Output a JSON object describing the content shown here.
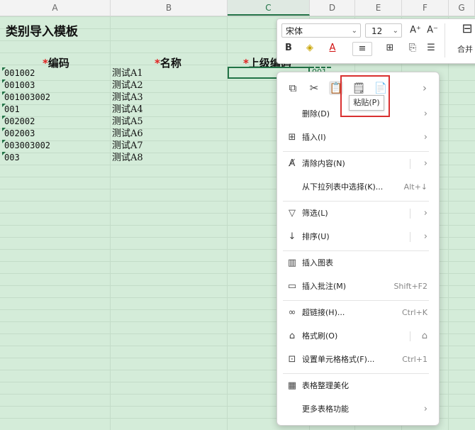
{
  "columns": [
    "A",
    "B",
    "C",
    "D",
    "E",
    "F",
    "G"
  ],
  "sheet": {
    "title": "类别导入模板",
    "headers": [
      {
        "star": "*",
        "label": "编码"
      },
      {
        "star": "*",
        "label": "名称"
      },
      {
        "star": "*",
        "label": "上级编码"
      }
    ],
    "rows": [
      {
        "code": "001002",
        "name": "测试A1"
      },
      {
        "code": "001003",
        "name": "测试A2"
      },
      {
        "code": "001003002",
        "name": "测试A3"
      },
      {
        "code": "001",
        "name": "测试A4"
      },
      {
        "code": "002002",
        "name": "测试A5"
      },
      {
        "code": "002003",
        "name": "测试A6"
      },
      {
        "code": "003003002",
        "name": "测试A7"
      },
      {
        "code": "003",
        "name": "测试A8"
      }
    ],
    "partial_cell_text": "001"
  },
  "toolbar": {
    "font": "宋体",
    "size": "12",
    "grow": "A⁺",
    "shrink": "A⁻",
    "bold": "B",
    "merge": "合并"
  },
  "context_menu": {
    "paste_tooltip": "粘贴(P)",
    "items": [
      {
        "icon": "delete-icon",
        "label": "删除(D)",
        "shortcut": "",
        "submenu": true
      },
      {
        "icon": "insert-icon",
        "label": "插入(I)",
        "shortcut": "",
        "submenu": true
      },
      {
        "icon": "clear-content-icon",
        "label": "清除内容(N)",
        "shortcut": "",
        "submenu": true
      },
      {
        "icon": "",
        "label": "从下拉列表中选择(K)...",
        "shortcut": "Alt+↓",
        "submenu": false
      },
      {
        "icon": "filter-icon",
        "label": "筛选(L)",
        "shortcut": "",
        "submenu": true
      },
      {
        "icon": "sort-icon",
        "label": "排序(U)",
        "shortcut": "",
        "submenu": true
      },
      {
        "icon": "chart-icon",
        "label": "插入图表",
        "shortcut": "",
        "submenu": false
      },
      {
        "icon": "comment-icon",
        "label": "插入批注(M)",
        "shortcut": "Shift+F2",
        "submenu": false
      },
      {
        "icon": "hyperlink-icon",
        "label": "超链接(H)...",
        "shortcut": "Ctrl+K",
        "submenu": false
      },
      {
        "icon": "format-painter-icon",
        "label": "格式刷(O)",
        "shortcut": "",
        "submenu": false
      },
      {
        "icon": "cell-format-icon",
        "label": "设置单元格格式(F)...",
        "shortcut": "Ctrl+1",
        "submenu": false
      },
      {
        "icon": "beautify-icon",
        "label": "表格整理美化",
        "shortcut": "",
        "submenu": false
      },
      {
        "icon": "",
        "label": "更多表格功能",
        "shortcut": "",
        "submenu": true
      }
    ]
  },
  "colors": {
    "selection": "#217346",
    "required": "#e02020",
    "highlight": "#d93030"
  }
}
